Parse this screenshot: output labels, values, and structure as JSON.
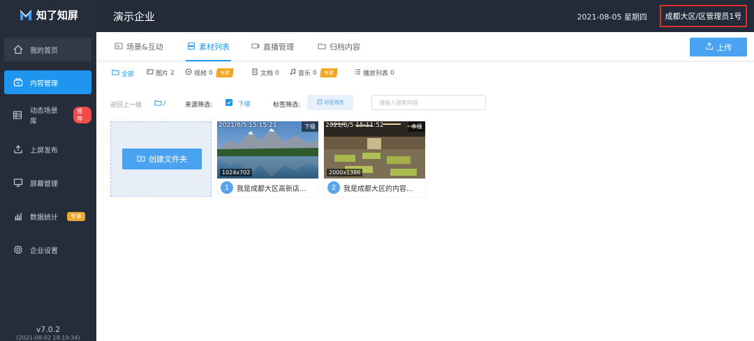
{
  "app": {
    "logo_text": "知了知屏",
    "company": "演示企业",
    "date": "2021-08-05 星期四",
    "user": "成都大区/区管理员1号",
    "version": "v7.0.2",
    "version_date": "(2021-08-02 18:19:34)"
  },
  "sidebar": {
    "items": [
      {
        "label": "我的首页"
      },
      {
        "label": "内容管理"
      },
      {
        "label": "动态场景库",
        "badge": "推荐"
      },
      {
        "label": "上屏发布"
      },
      {
        "label": "屏幕管理"
      },
      {
        "label": "数据统计",
        "badge": "专享"
      },
      {
        "label": "企业设置"
      }
    ]
  },
  "tabs": {
    "items": [
      {
        "label": "场景&互动"
      },
      {
        "label": "素材列表"
      },
      {
        "label": "直播管理"
      },
      {
        "label": "归档内容"
      }
    ],
    "upload_label": "上传"
  },
  "filetypes": {
    "all": "全部",
    "image": "图片",
    "image_count": "2",
    "video": "视频",
    "video_count": "0",
    "video_badge": "专享",
    "doc": "文档",
    "doc_count": "0",
    "music": "音乐",
    "music_count": "0",
    "music_badge": "专享",
    "playlist": "播放列表",
    "playlist_count": "0"
  },
  "filter": {
    "back_label": "返回上一级",
    "path": "/",
    "source_label": "来源筛选:",
    "source_option": "下级",
    "tag_label": "标签筛选:",
    "tag_button": "标签筛选",
    "search_placeholder": "请输入搜索内容"
  },
  "new_folder_label": "创建文件夹",
  "media": [
    {
      "time": "2021/8/5 15:15:21",
      "level": "下级",
      "resolution": "1024x702",
      "num": "1",
      "title": "我是成都大区高新店..."
    },
    {
      "time": "2021/8/5 15:11:52",
      "level": "本级",
      "resolution": "2000x1386",
      "num": "2",
      "title": "我是成都大区的内容..."
    }
  ],
  "colors": {
    "accent": "#1e95ef",
    "sidebar_bg": "#252d3b",
    "header_bg": "#232b38",
    "highlight_border": "#e03030",
    "vip_badge": "#f5a623",
    "recommend_badge": "#f04a4a"
  }
}
